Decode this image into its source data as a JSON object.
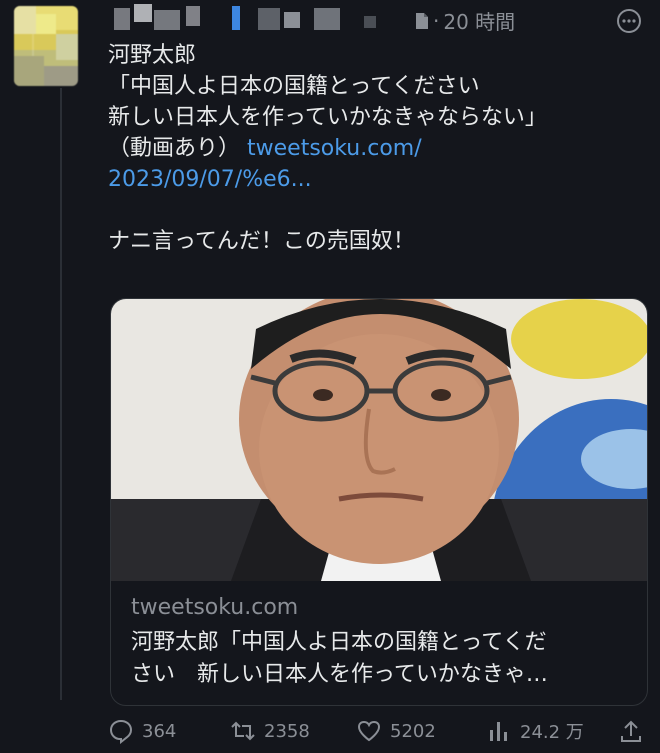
{
  "tweet": {
    "time": "20 時間",
    "text_lines": [
      "河野太郎",
      "「中国人よ日本の国籍とってください",
      "新しい日本人を作っていかなきゃならない」",
      "（動画あり） "
    ],
    "link_part1": "tweetsoku.com/",
    "link_part2": "2023/09/07/%e6...",
    "comment": "ナニ言ってんだ！この売国奴！"
  },
  "card": {
    "domain": "tweetsoku.com",
    "title_line1": "河野太郎「中国人よ日本の国籍とってくだ",
    "title_line2": "さい　新しい日本人を作っていかなきゃ…"
  },
  "actions": {
    "replies": "364",
    "retweets": "2358",
    "likes": "5202",
    "views": "24.2 万"
  },
  "icons": [
    "doc-icon",
    "more-icon",
    "reply-icon",
    "retweet-icon",
    "like-icon",
    "views-icon",
    "share-icon"
  ]
}
